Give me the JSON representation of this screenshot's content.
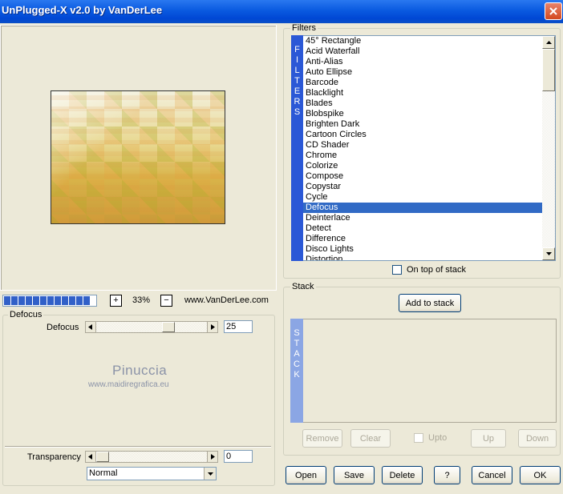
{
  "window": {
    "title": "UnPlugged-X v2.0 by VanDerLee"
  },
  "preview": {
    "progress_segments": 12,
    "zoom_plus": "+",
    "zoom_minus": "−",
    "zoom_value": "33%",
    "website": "www.VanDerLee.com"
  },
  "defocus": {
    "group_label": "Defocus",
    "param_label": "Defocus",
    "value": "25",
    "slider_fraction": 0.25,
    "transparency_label": "Transparency",
    "transparency_value": "0",
    "transparency_fraction": 0,
    "blend_mode": "Normal"
  },
  "watermark": {
    "line1": "Pinuccia",
    "line2": "www.maidiregrafica.eu"
  },
  "filters": {
    "group_label": "Filters",
    "strip_text": [
      "F",
      "I",
      "L",
      "T",
      "E",
      "R",
      "S"
    ],
    "items": [
      "45° Rectangle",
      "Acid Waterfall",
      "Anti-Alias",
      "Auto Ellipse",
      "Barcode",
      "Blacklight",
      "Blades",
      "Blobspike",
      "Brighten Dark",
      "Cartoon Circles",
      "CD Shader",
      "Chrome",
      "Colorize",
      "Compose",
      "Copystar",
      "Cycle",
      "Defocus",
      "Deinterlace",
      "Detect",
      "Difference",
      "Disco Lights",
      "Distortion"
    ],
    "selected": "Defocus",
    "on_top_label": "On top of stack"
  },
  "stack": {
    "group_label": "Stack",
    "add_label": "Add to stack",
    "strip_text": [
      "S",
      "T",
      "A",
      "C",
      "K"
    ],
    "remove_label": "Remove",
    "clear_label": "Clear",
    "upto_label": "Upto",
    "up_label": "Up",
    "down_label": "Down"
  },
  "footer": {
    "open": "Open",
    "save": "Save",
    "delete": "Delete",
    "help": "?",
    "cancel": "Cancel",
    "ok": "OK"
  },
  "colors": {
    "title_bar": "#0a5ae0",
    "selection": "#316ac5",
    "strip": "#2b58d6",
    "close": "#d4491f"
  }
}
